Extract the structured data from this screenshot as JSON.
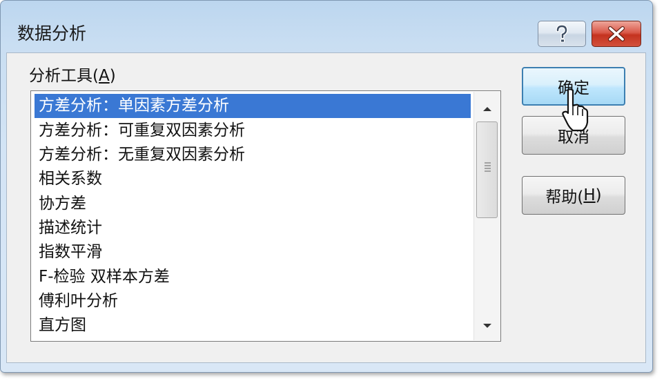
{
  "window": {
    "title": "数据分析",
    "help_icon": "question-mark-icon",
    "close_icon": "close-icon"
  },
  "tools": {
    "label_prefix": "分析工具(",
    "label_key": "A",
    "label_suffix": ")",
    "items": [
      "方差分析：单因素方差分析",
      "方差分析：可重复双因素分析",
      "方差分析：无重复双因素分析",
      "相关系数",
      "协方差",
      "描述统计",
      "指数平滑",
      "F-检验 双样本方差",
      "傅利叶分析",
      "直方图"
    ],
    "selected_index": 0
  },
  "buttons": {
    "ok": "确定",
    "cancel": "取消",
    "help_prefix": "帮助(",
    "help_key": "H",
    "help_suffix": ")"
  },
  "colors": {
    "selection": "#3a78d4",
    "close_button": "#c4321f",
    "default_button_border": "#3c7fb1"
  }
}
